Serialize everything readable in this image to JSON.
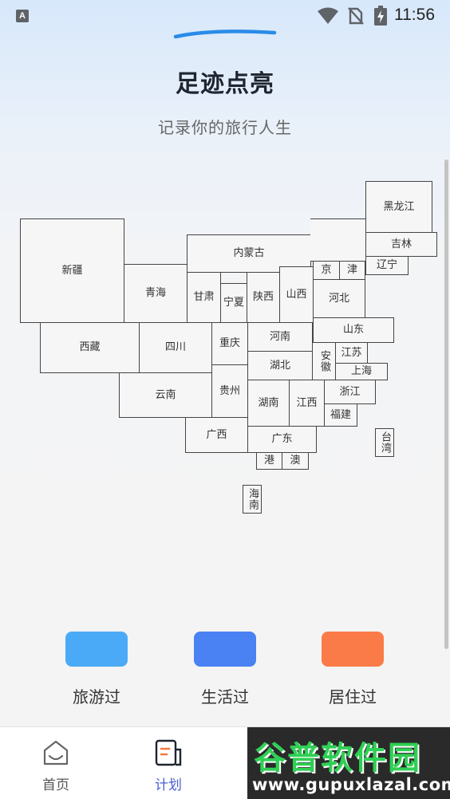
{
  "status_bar": {
    "time": "11:56",
    "app_icon_letter": "A",
    "icons": [
      "app-notification-icon",
      "wifi-icon",
      "no-sim-icon",
      "battery-charging-icon"
    ]
  },
  "header": {
    "title": "足迹点亮",
    "subtitle": "记录你的旅行人生",
    "accent_color": "#2a8be8"
  },
  "map": {
    "provinces": [
      {
        "id": "heilongjiang",
        "name": "黑龙江"
      },
      {
        "id": "jilin",
        "name": "吉林"
      },
      {
        "id": "liaoning",
        "name": "辽宁"
      },
      {
        "id": "xinjiang",
        "name": "新疆"
      },
      {
        "id": "neimenggu",
        "name": "内蒙古"
      },
      {
        "id": "beijing",
        "name": "京"
      },
      {
        "id": "tianjin",
        "name": "津"
      },
      {
        "id": "qinghai",
        "name": "青海"
      },
      {
        "id": "gansu",
        "name": "甘肃"
      },
      {
        "id": "ningxia",
        "name": "宁夏"
      },
      {
        "id": "shaanxi",
        "name": "陕西"
      },
      {
        "id": "shanxi",
        "name": "山西"
      },
      {
        "id": "hebei",
        "name": "河北"
      },
      {
        "id": "shandong",
        "name": "山东"
      },
      {
        "id": "xizang",
        "name": "西藏"
      },
      {
        "id": "sichuan",
        "name": "四川"
      },
      {
        "id": "chongqing",
        "name": "重庆"
      },
      {
        "id": "henan",
        "name": "河南"
      },
      {
        "id": "anhui",
        "name": "安徽"
      },
      {
        "id": "jiangsu",
        "name": "江苏"
      },
      {
        "id": "hubei",
        "name": "湖北"
      },
      {
        "id": "shanghai",
        "name": "上海"
      },
      {
        "id": "yunnan",
        "name": "云南"
      },
      {
        "id": "guizhou",
        "name": "贵州"
      },
      {
        "id": "hunan",
        "name": "湖南"
      },
      {
        "id": "jiangxi",
        "name": "江西"
      },
      {
        "id": "zhejiang",
        "name": "浙江"
      },
      {
        "id": "fujian",
        "name": "福建"
      },
      {
        "id": "taiwan",
        "name": "台湾"
      },
      {
        "id": "guangxi",
        "name": "广西"
      },
      {
        "id": "guangdong",
        "name": "广东"
      },
      {
        "id": "hongkong",
        "name": "港"
      },
      {
        "id": "macau",
        "name": "澳"
      },
      {
        "id": "hainan",
        "name": "海南"
      }
    ]
  },
  "legend": [
    {
      "label": "旅游过",
      "color": "#4baaf7"
    },
    {
      "label": "生活过",
      "color": "#4a82f4"
    },
    {
      "label": "居住过",
      "color": "#fb7b48"
    }
  ],
  "tab_bar": {
    "tabs": [
      {
        "label": "首页",
        "icon": "home-icon",
        "active": false
      },
      {
        "label": "计划",
        "icon": "plan-icon",
        "active": true
      }
    ],
    "active_color": "#4a5fd0",
    "inactive_color": "#555555"
  },
  "watermark": {
    "main": "谷普软件园",
    "sub": "www.gupuxlazal.com"
  }
}
